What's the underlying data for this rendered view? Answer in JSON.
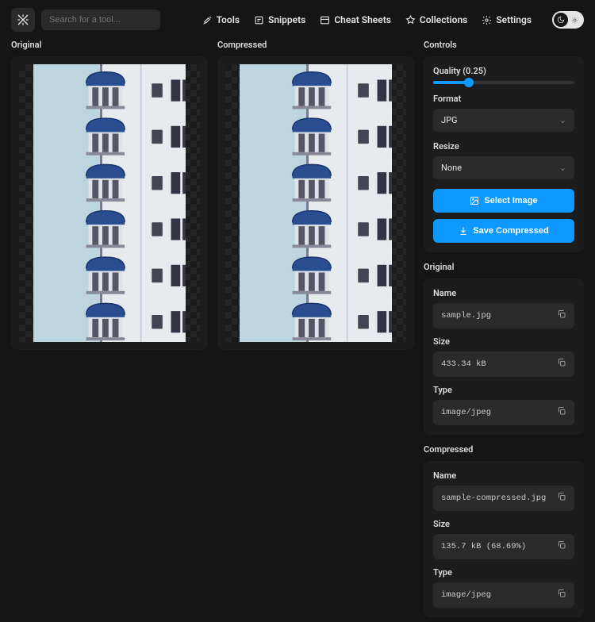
{
  "search": {
    "placeholder": "Search for a tool..."
  },
  "nav": {
    "tools": "Tools",
    "snippets": "Snippets",
    "cheatSheets": "Cheat Sheets",
    "collections": "Collections",
    "settings": "Settings"
  },
  "panels": {
    "original": "Original",
    "compressed": "Compressed"
  },
  "controls": {
    "title": "Controls",
    "qualityLabel": "Quality (0.25)",
    "qualityValue": 0.25,
    "formatLabel": "Format",
    "formatValue": "JPG",
    "resizeLabel": "Resize",
    "resizeValue": "None",
    "selectImage": "Select Image",
    "saveCompressed": "Save Compressed"
  },
  "originalInfo": {
    "title": "Original",
    "nameLabel": "Name",
    "nameValue": "sample.jpg",
    "sizeLabel": "Size",
    "sizeValue": "433.34 kB",
    "typeLabel": "Type",
    "typeValue": "image/jpeg"
  },
  "compressedInfo": {
    "title": "Compressed",
    "nameLabel": "Name",
    "nameValue": "sample-compressed.jpg",
    "sizeLabel": "Size",
    "sizeValue": "135.7 kB (68.69%)",
    "typeLabel": "Type",
    "typeValue": "image/jpeg"
  }
}
